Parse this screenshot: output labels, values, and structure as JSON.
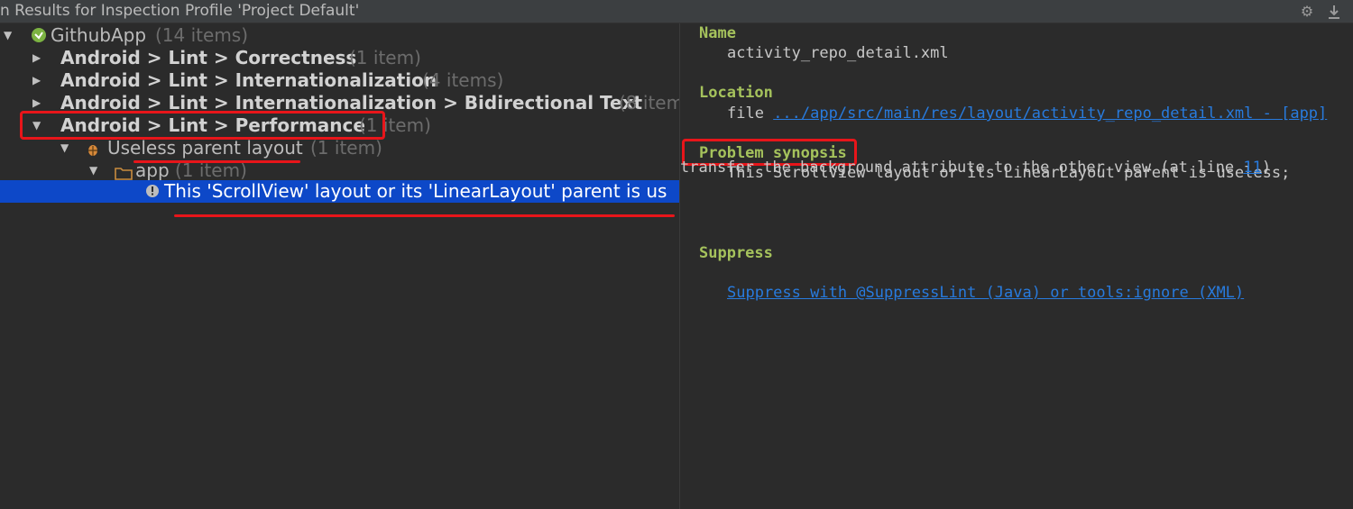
{
  "header": {
    "title": "n Results for Inspection Profile 'Project Default'"
  },
  "tree": {
    "root": {
      "label": "GithubApp",
      "count": "(14 items)"
    },
    "categories": [
      {
        "path": "Android > Lint > Correctness",
        "count": "(1 item)"
      },
      {
        "path": "Android > Lint > Internationalization",
        "count": "(4 items)"
      },
      {
        "path": "Android > Lint > Internationalization > Bidirectional Text",
        "count": "(8 item"
      },
      {
        "path": "Android > Lint > Performance",
        "count": "(1 item)"
      }
    ],
    "issue": {
      "label": "Useless parent layout",
      "count": "(1 item)"
    },
    "folder": {
      "label": "app",
      "count": "(1 item)"
    },
    "selected_item": "This 'ScrollView' layout or its 'LinearLayout' parent is us"
  },
  "overflow_text": "transfer the background attribute to the other view (at line ",
  "details": {
    "name_label": "Name",
    "name_value": "activity_repo_detail.xml",
    "location_label": "Location",
    "location_prefix": "file ",
    "location_link": ".../app/src/main/res/layout/activity_repo_detail.xml - [app]",
    "synopsis_label": "Problem synopsis",
    "synopsis_text": "This ScrollView layout or its LinearLayout parent is useless;",
    "line_link": "11",
    "line_suffix": ")",
    "suppress_label": "Suppress",
    "suppress_link": "Suppress with @SuppressLint (Java) or tools:ignore (XML)"
  },
  "colors": {
    "background": "#2b2b2b",
    "selection": "#0d48c8",
    "section_heading": "#a5c25c",
    "link": "#287bde",
    "annotation": "#e8151a"
  },
  "icons": [
    "android-icon",
    "bug-icon",
    "folder-icon",
    "info-icon",
    "gear-icon",
    "download-icon"
  ]
}
